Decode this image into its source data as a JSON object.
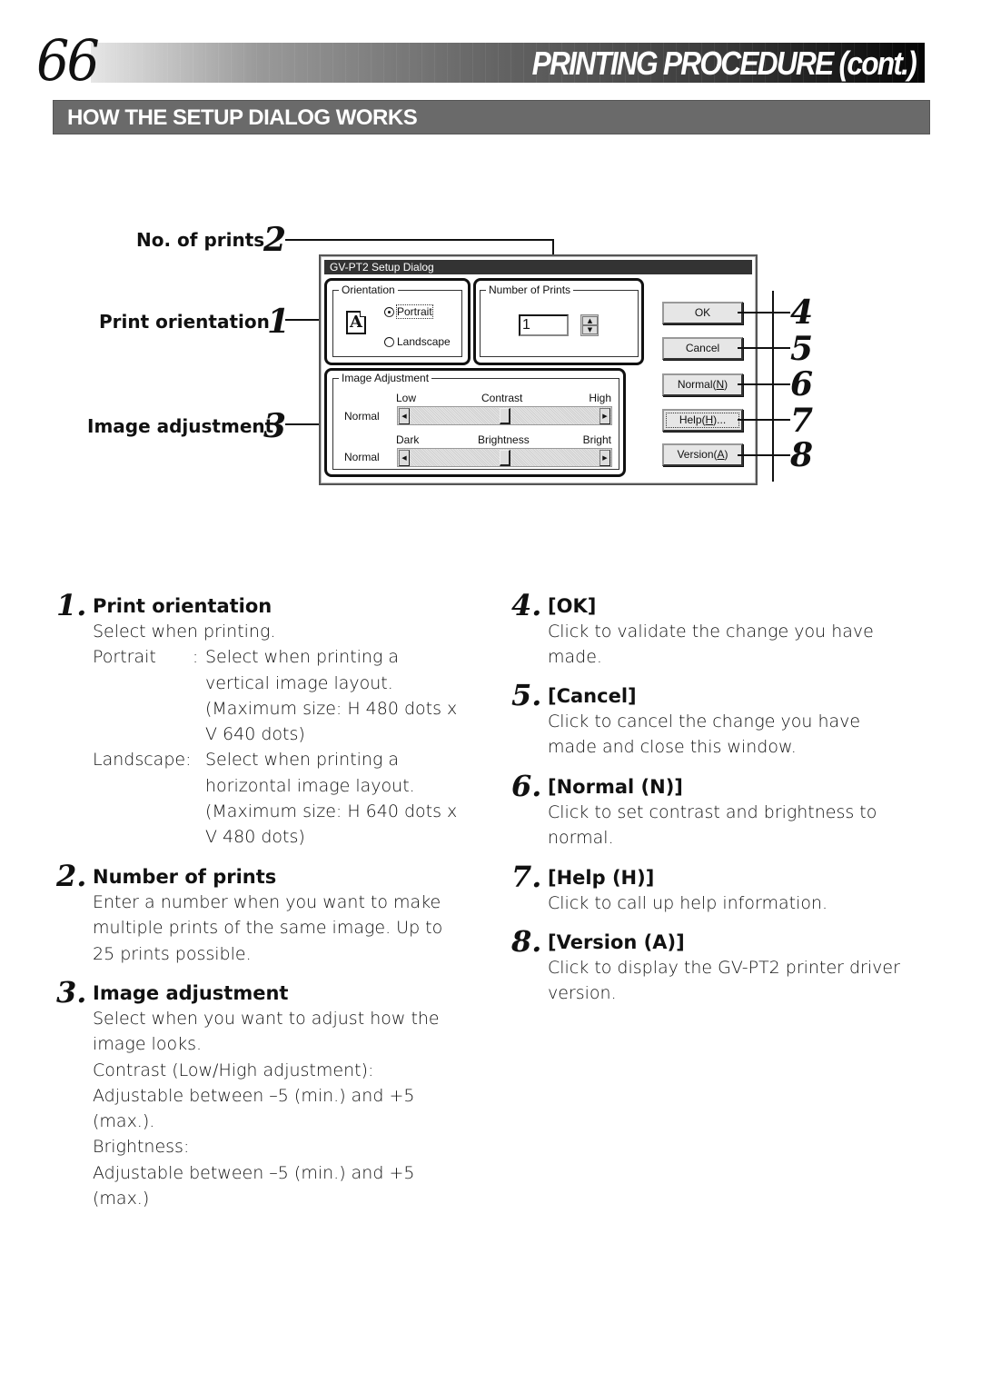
{
  "header": {
    "page_number": "66",
    "title": "PRINTING PROCEDURE (cont.)",
    "section_title": "HOW THE SETUP DIALOG WORKS"
  },
  "callouts": [
    {
      "num": "2",
      "label": "No. of prints"
    },
    {
      "num": "1",
      "label": "Print orientation"
    },
    {
      "num": "3",
      "label": "Image adjustment"
    },
    {
      "num": "4",
      "label": ""
    },
    {
      "num": "5",
      "label": ""
    },
    {
      "num": "6",
      "label": ""
    },
    {
      "num": "7",
      "label": ""
    },
    {
      "num": "8",
      "label": ""
    }
  ],
  "dialog": {
    "title": "GV-PT2 Setup Dialog",
    "orientation": {
      "label": "Orientation",
      "icon": "document-portrait-icon",
      "icon_glyph": "A",
      "options": [
        {
          "label": "Portrait",
          "selected": true
        },
        {
          "label": "Landscape",
          "selected": false
        }
      ]
    },
    "number_of_prints": {
      "label": "Number of Prints",
      "value": "1"
    },
    "image_adjustment": {
      "label": "Image Adjustment",
      "contrast": {
        "name": "Contrast",
        "low_label": "Low",
        "high_label": "High",
        "status": "Normal",
        "value": 0,
        "min": -5,
        "max": 5
      },
      "brightness": {
        "name": "Brightness",
        "low_label": "Dark",
        "high_label": "Bright",
        "status": "Normal",
        "value": 0,
        "min": -5,
        "max": 5
      }
    },
    "buttons": {
      "ok": "OK",
      "cancel": "Cancel",
      "normal_prefix": "Normal(",
      "normal_key": "N",
      "normal_suffix": ")",
      "help_prefix": "Help(",
      "help_key": "H",
      "help_suffix": ")...",
      "version_prefix": "Version(",
      "version_key": "A",
      "version_suffix": ")"
    }
  },
  "descriptions": {
    "left": [
      {
        "num": "1.",
        "title": "Print orientation",
        "intro": "Select when printing.",
        "terms": [
          {
            "term": "Portrait",
            "sep": ":",
            "lines": [
              "Select when printing a",
              "vertical image layout.",
              "(Maximum size: H 480 dots x",
              "V 640 dots)"
            ]
          },
          {
            "term": "Landscape",
            "sep": ":",
            "lines": [
              "Select when printing a",
              "horizontal image layout.",
              "(Maximum size: H 640 dots x",
              "V 480 dots)"
            ]
          }
        ]
      },
      {
        "num": "2.",
        "title": "Number of prints",
        "lines": [
          "Enter a number when you want to make",
          "multiple prints of the same image. Up to",
          "25 prints possible."
        ]
      },
      {
        "num": "3.",
        "title": "Image adjustment",
        "lines": [
          "Select when you want to adjust how the",
          "image looks.",
          "Contrast (Low/High adjustment):",
          "Adjustable between –5 (min.) and +5",
          "(max.).",
          "Brightness:",
          "Adjustable between –5 (min.) and +5",
          "(max.)"
        ]
      }
    ],
    "right": [
      {
        "num": "4.",
        "title": "[OK]",
        "lines": [
          "Click to validate the change you have",
          "made."
        ]
      },
      {
        "num": "5.",
        "title": "[Cancel]",
        "lines": [
          "Click to cancel the change you have",
          "made and close this window."
        ]
      },
      {
        "num": "6.",
        "title": "[Normal (N)]",
        "lines": [
          "Click to set contrast and brightness to",
          "normal."
        ]
      },
      {
        "num": "7.",
        "title": "[Help (H)]",
        "lines": [
          "Click to call up help information."
        ]
      },
      {
        "num": "8.",
        "title": "[Version (A)]",
        "lines": [
          "Click to display the GV-PT2 printer driver",
          "version."
        ]
      }
    ]
  }
}
